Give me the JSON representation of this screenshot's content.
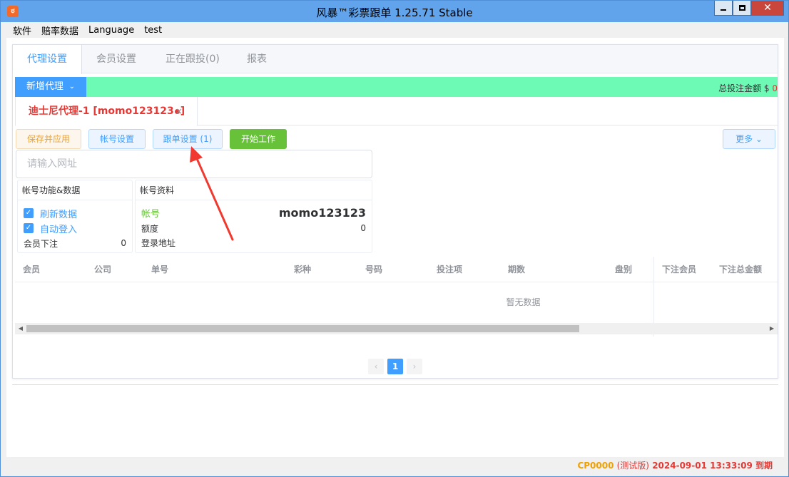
{
  "window": {
    "title": "风暴™彩票跟单 1.25.71 Stable",
    "icon_glyph": "ಠ",
    "min_glyph": "",
    "close_glyph": "✕"
  },
  "menu": [
    "软件",
    "赔率数据",
    "Language",
    "test"
  ],
  "top_tabs": [
    "代理设置",
    "会员设置",
    "正在跟投(0)",
    "报表"
  ],
  "toolbar": {
    "add_agent": "新增代理",
    "add_agent_chevron": "⌄",
    "total_label": "总投注金额 $",
    "total_value": "0"
  },
  "sub_tab": {
    "label_prefix": "迪士尼代理-1 [momo123123",
    "label_suffix": "]",
    "close": "×"
  },
  "actions": {
    "save": "保存并应用",
    "account_settings": "帐号设置",
    "follow_settings": "跟单设置 (1)",
    "start_work": "开始工作",
    "more": "更多 ⌄"
  },
  "url_input": {
    "placeholder": "请输入网址",
    "value": ""
  },
  "account_panel": {
    "title": "帐号功能&数据",
    "refresh": "刷新数据",
    "auto_login": "自动登入",
    "member_bet_label": "会员下注",
    "member_bet_value": "0",
    "check": "✓"
  },
  "profile_panel": {
    "title": "帐号资料",
    "account_label": "帐号",
    "account_value": "momo123123",
    "quota_label": "额度",
    "quota_value": "0",
    "login_url_label": "登录地址"
  },
  "table": {
    "columns": [
      "会员",
      "公司",
      "单号",
      "彩种",
      "号码",
      "投注项",
      "期数",
      "盘别",
      "下注会员",
      "下注总金额"
    ],
    "empty": "暂无数据",
    "scroll_left": "◀",
    "scroll_right": "▶"
  },
  "pagination": {
    "prev": "‹",
    "current": "1",
    "next": "›"
  },
  "status": {
    "code": "CP0000",
    "edition": "(测试版)",
    "expiry": "2024-09-01 13:33:09 到期"
  },
  "colors": {
    "titlebar": "#62a4ec",
    "accent": "#409eff",
    "green_bar": "#6dfab4",
    "start_button": "#67c23a",
    "warning": "#e6a23c",
    "danger": "#e53935"
  }
}
